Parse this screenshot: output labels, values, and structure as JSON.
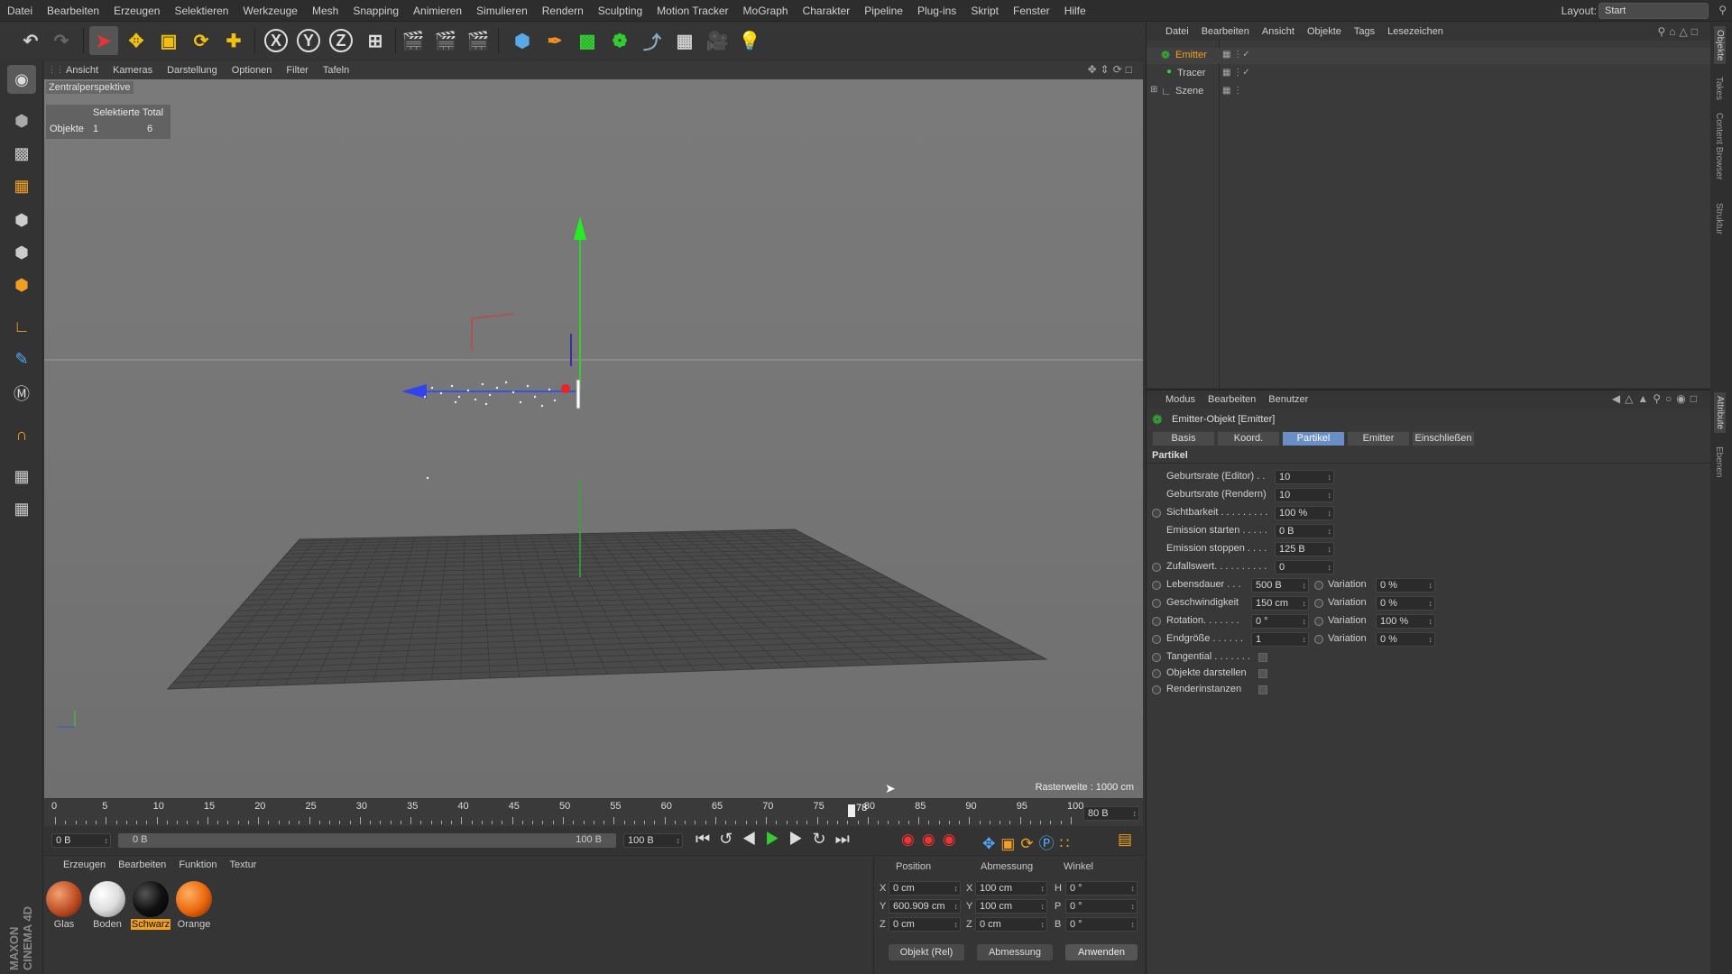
{
  "menubar": {
    "items": [
      "Datei",
      "Bearbeiten",
      "Erzeugen",
      "Selektieren",
      "Werkzeuge",
      "Mesh",
      "Snapping",
      "Animieren",
      "Simulieren",
      "Rendern",
      "Sculpting",
      "Motion Tracker",
      "MoGraph",
      "Charakter",
      "Pipeline",
      "Plug-ins",
      "Skript",
      "Fenster",
      "Hilfe"
    ],
    "layout_label": "Layout:",
    "layout_value": "Start"
  },
  "toolbar": {
    "axis_x": "X",
    "axis_y": "Y",
    "axis_z": "Z"
  },
  "viewport": {
    "menu": [
      "Ansicht",
      "Kameras",
      "Darstellung",
      "Optionen",
      "Filter",
      "Tafeln"
    ],
    "title": "Zentralperspektive",
    "stats_header": "Selektierte Total",
    "stats_label": "Objekte",
    "stats_selected": "1",
    "stats_total": "6",
    "raster": "Rasterweite : 1000 cm"
  },
  "timeline": {
    "ticks": [
      "0",
      "5",
      "10",
      "15",
      "20",
      "25",
      "30",
      "35",
      "40",
      "45",
      "50",
      "55",
      "60",
      "65",
      "70",
      "75",
      "80",
      "85",
      "90",
      "95",
      "100"
    ],
    "current_frame": "78",
    "end_display": "80 B",
    "start_field": "0 B",
    "range_start": "0 B",
    "range_end": "100 B",
    "end_field": "100 B"
  },
  "materials": {
    "menu": [
      "Erzeugen",
      "Bearbeiten",
      "Funktion",
      "Textur"
    ],
    "items": [
      {
        "name": "Glas",
        "color": "#b5461e"
      },
      {
        "name": "Boden",
        "color": "#e6e6e6"
      },
      {
        "name": "Schwarz",
        "color": "#111111"
      },
      {
        "name": "Orange",
        "color": "#e8650c"
      }
    ],
    "brand": "MAXON CINEMA 4D"
  },
  "coords": {
    "headers": [
      "Position",
      "Abmessung",
      "Winkel"
    ],
    "pos": {
      "x": "0 cm",
      "y": "600.909 cm",
      "z": "0 cm"
    },
    "size": {
      "x": "100 cm",
      "y": "100 cm",
      "z": "0 cm"
    },
    "rot": {
      "h": "0 °",
      "p": "0 °",
      "b": "0 °"
    },
    "labels": {
      "x": "X",
      "y": "Y",
      "z": "Z",
      "h": "H",
      "p": "P",
      "b": "B"
    },
    "mode_select": "Objekt (Rel)",
    "size_select": "Abmessung",
    "apply": "Anwenden"
  },
  "objects": {
    "menu": [
      "Datei",
      "Bearbeiten",
      "Ansicht",
      "Objekte",
      "Tags",
      "Lesezeichen"
    ],
    "items": [
      "Emitter",
      "Tracer",
      "Szene"
    ]
  },
  "attributes": {
    "menu": [
      "Modus",
      "Bearbeiten",
      "Benutzer"
    ],
    "object_title": "Emitter-Objekt [Emitter]",
    "tabs": [
      "Basis",
      "Koord.",
      "Partikel",
      "Emitter",
      "Einschließen"
    ],
    "active_tab": "Partikel",
    "section": "Partikel",
    "rows": {
      "birth_editor": {
        "label": "Geburtsrate (Editor) . .",
        "value": "10"
      },
      "birth_render": {
        "label": "Geburtsrate (Rendern)",
        "value": "10"
      },
      "visibility": {
        "label": "Sichtbarkeit . . . . . . . . .",
        "value": "100 %"
      },
      "emit_start": {
        "label": "Emission starten . . . . .",
        "value": "0 B"
      },
      "emit_stop": {
        "label": "Emission stoppen . . . .",
        "value": "125 B"
      },
      "seed": {
        "label": "Zufallswert. . . . . . . . . .",
        "value": "0"
      },
      "lifetime": {
        "label": "Lebensdauer . . .",
        "value": "500 B",
        "var_label": "Variation",
        "var": "0 %"
      },
      "speed": {
        "label": "Geschwindigkeit",
        "value": "150 cm",
        "var_label": "Variation",
        "var": "0 %"
      },
      "rotation": {
        "label": "Rotation. . . . . . .",
        "value": "0 °",
        "var_label": "Variation",
        "var": "100 %"
      },
      "endscale": {
        "label": "Endgröße . . . . . .",
        "value": "1",
        "var_label": "Variation",
        "var": "0 %"
      },
      "tangential": {
        "label": "Tangential . . . . . . ."
      },
      "show_objects": {
        "label": "Objekte darstellen"
      },
      "render_instances": {
        "label": "Renderinstanzen"
      }
    }
  },
  "rightstrip": {
    "tabs": [
      "Objekte",
      "Takes",
      "Content Browser",
      "Struktur"
    ],
    "tabs2": [
      "Attribute",
      "Ebenen"
    ]
  }
}
